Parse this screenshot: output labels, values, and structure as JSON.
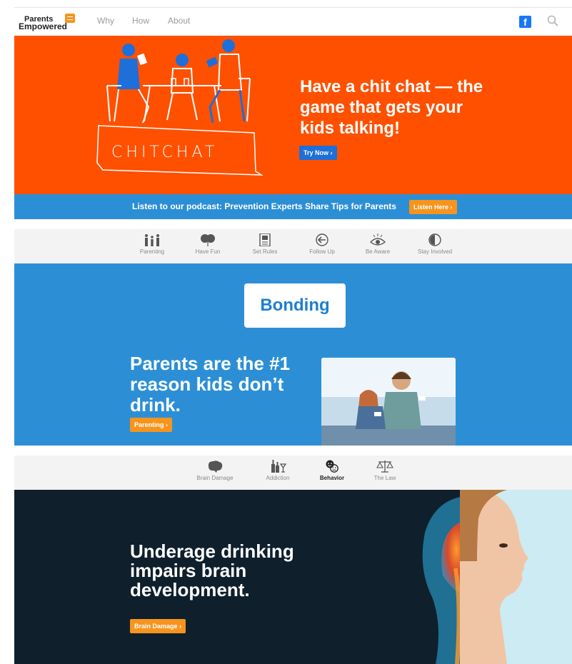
{
  "header": {
    "logo_line1": "Parents",
    "logo_line2": "Empowered",
    "nav": [
      "Why",
      "How",
      "About"
    ],
    "facebook_label": "f"
  },
  "hero": {
    "title": "Have a chit chat — the game that gets your kids talking!",
    "button": "Try Now ›",
    "illustration_text": "CHITCHAT",
    "bg_color": "#ff5000"
  },
  "podcast": {
    "text": "Listen to our podcast: Prevention Experts Share Tips for Parents",
    "button": "Listen Here ›"
  },
  "tabs1": [
    {
      "label": "Parenting",
      "icon": "family-icon"
    },
    {
      "label": "Have Fun",
      "icon": "balloons-icon"
    },
    {
      "label": "Set Rules",
      "icon": "document-icon"
    },
    {
      "label": "Follow Up",
      "icon": "arrow-circle-icon"
    },
    {
      "label": "Be Aware",
      "icon": "eye-icon"
    },
    {
      "label": "Stay Involved",
      "icon": "circle-icon"
    }
  ],
  "bonding": {
    "badge": "Bonding",
    "title": "Parents are the #1 reason kids don’t drink.",
    "button": "Parenting ›"
  },
  "tabs2": [
    {
      "label": "Brain Damage",
      "icon": "brain-icon"
    },
    {
      "label": "Addiction",
      "icon": "bottles-icon"
    },
    {
      "label": "Behavior",
      "icon": "faces-icon",
      "active": true
    },
    {
      "label": "The Law",
      "icon": "scales-icon"
    }
  ],
  "brain": {
    "title": "Underage drinking impairs brain development.",
    "button": "Brain Damage ›"
  },
  "colors": {
    "orange_hero": "#ff5000",
    "blue": "#2c8fd6",
    "button_blue": "#1e6fd9",
    "button_orange": "#f7941d",
    "dark_navy": "#0f1f2c"
  }
}
